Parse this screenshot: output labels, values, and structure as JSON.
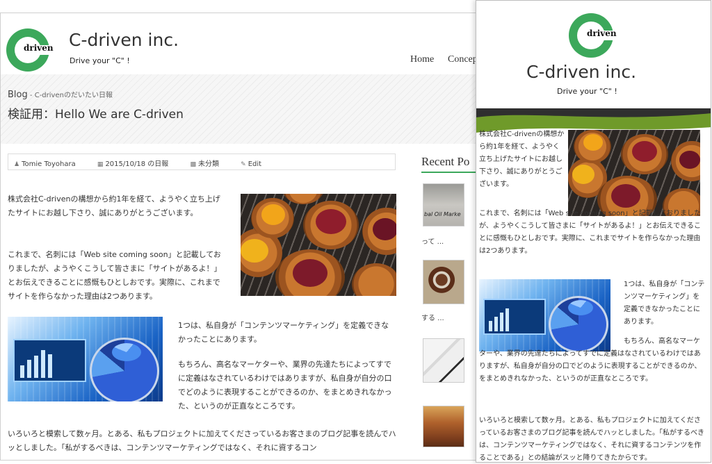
{
  "site": {
    "title": "C-driven inc.",
    "tagline": "Drive your \"C\" !",
    "logo_text": "driven"
  },
  "nav": {
    "items": [
      "Home",
      "Concep"
    ]
  },
  "breadcrumb": {
    "blog": "Blog",
    "sub": " - C-drivenのだいたい日報"
  },
  "post": {
    "title": "検証用：Hello We are C-driven",
    "meta": {
      "author": "Tomie Toyohara",
      "date": "2015/10/18 の日報",
      "category": "未分類",
      "edit": "Edit"
    },
    "p1": "株式会社C-drivenの構想から約1年を経て、ようやく立ち上げたサイトにお越し下さり、誠にありがとうございます。",
    "p2": "これまで、名刺には「Web site coming soon」と記載しておりましたが、ようやくこうして皆さまに「サイトがあるよ！」とお伝えできることに感慨もひとしおです。実際に、これまでサイトを作らなかった理由は2つあります。",
    "p3": "1つは、私自身が「コンテンツマーケティング」を定義できなかったことにあります。",
    "p4": "もちろん、高名なマーケターや、業界の先達たちによってすでに定義はなされているわけではありますが、私自身が自分の口でどのように表現することができるのか、をまとめきれなかった、というのが正直なところです。",
    "p5": "いろいろと模索して数ヶ月。とある、私もプロジェクトに加えてくださっているお客さまのブログ記事を読んでハッとしました。「私がするべきは、コンテンツマーケティングではなく、それに資するコン",
    "p5_mobile": "いろいろと模索して数ヶ月。とある、私もプロジェクトに加えてくださっているお客さまのブログ記事を読んでハッとしました。「私がするべきは、コンテンツマーケティングではなく、それに資するコンテンツを作ることである」との結論がスッと降りてきたからです。"
  },
  "sidebar": {
    "recent_title": "Recent Po",
    "items": [
      {
        "caption": "bal Oil Marke",
        "excerpt": "って ..."
      },
      {
        "excerpt": "する ..."
      },
      {
        "excerpt": ""
      },
      {
        "excerpt": ""
      }
    ]
  },
  "colors": {
    "brand_green": "#3ca85b",
    "band_green": "#6f9a2a"
  },
  "icons": [
    "user-icon",
    "calendar-icon",
    "folder-icon",
    "pencil-icon"
  ]
}
